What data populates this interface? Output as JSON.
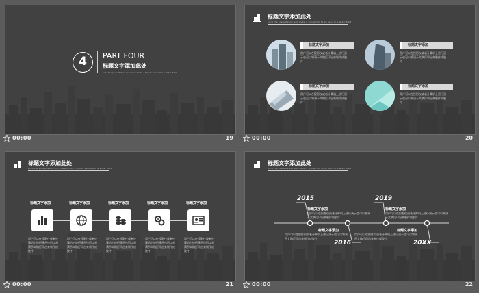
{
  "footer": {
    "time": "00:00"
  },
  "slide19": {
    "number_badge": "4",
    "part_label": "PART FOUR",
    "title": "标题文字添加此处",
    "subtitle": "print the presentation and make it into a film to be used in a wider field",
    "page": "19"
  },
  "slide20": {
    "title": "标题文字添加此处",
    "subtitle": "print the presentation and make it into a film to be used in a wider field",
    "page": "20",
    "items": [
      {
        "label": "标题文字添加",
        "desc": "用户可以在投影仪或者计算机上进行演示也可以将演示文稿打印出来制作成胶片"
      },
      {
        "label": "标题文字添加",
        "desc": "用户可以在投影仪或者计算机上进行演示也可以将演示文稿打印出来制作成胶片"
      },
      {
        "label": "标题文字添加",
        "desc": "用户可以在投影仪或者计算机上进行演示也可以将演示文稿打印出来制作成胶片"
      },
      {
        "label": "标题文字添加",
        "desc": "用户可以在投影仪或者计算机上进行演示也可以将演示文稿打印出来制作成胶片"
      }
    ]
  },
  "slide21": {
    "title": "标题文字添加此处",
    "subtitle": "print the presentation and make it into a film to be used in a wider field",
    "page": "21",
    "steps": [
      {
        "title": "标题文字添加",
        "icon": "chart-icon",
        "desc": "用户可以在投影仪或者计算机上进行演示也可以将演示文稿打印出来制作成胶片"
      },
      {
        "title": "标题文字添加",
        "icon": "globe-icon",
        "desc": "用户可以在投影仪或者计算机上进行演示也可以将演示文稿打印出来制作成胶片"
      },
      {
        "title": "标题文字添加",
        "icon": "coins-icon",
        "desc": "用户可以在投影仪或者计算机上进行演示也可以将演示文稿打印出来制作成胶片"
      },
      {
        "title": "标题文字添加",
        "icon": "gears-icon",
        "desc": "用户可以在投影仪或者计算机上进行演示也可以将演示文稿打印出来制作成胶片"
      },
      {
        "title": "标题文字添加",
        "icon": "id-card-icon",
        "desc": "用户可以在投影仪或者计算机上进行演示也可以将演示文稿打印出来制作成胶片"
      }
    ]
  },
  "slide22": {
    "title": "标题文字添加此处",
    "subtitle": "print the presentation and make it into a film to be used in a wider field",
    "page": "22",
    "timeline": [
      {
        "year": "2015",
        "title": "标题文字添加",
        "desc": "用户可以在投影仪或者计算机上进行演示也可以将演示文稿打印出来制作成胶片"
      },
      {
        "year": "2016",
        "title": "标题文字添加",
        "desc": "用户可以在投影仪或者计算机上进行演示也可以将演示文稿打印出来制作成胶片"
      },
      {
        "year": "2019",
        "title": "标题文字添加",
        "desc": "用户可以在投影仪或者计算机上进行演示也可以将演示文稿打印出来制作成胶片"
      },
      {
        "year": "20XX",
        "title": "标题文字添加",
        "desc": "用户可以在投影仪或者计算机上进行演示也可以将演示文稿打印出来制作成胶片"
      }
    ]
  },
  "colors": {
    "background": "#5b5b5b",
    "slide": "#414141",
    "label_bar": "#d9d9d9",
    "text": "#ffffff"
  }
}
